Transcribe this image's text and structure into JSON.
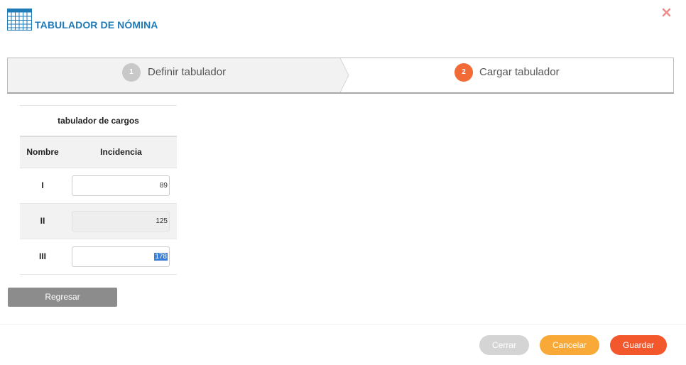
{
  "header": {
    "title": "TABULADOR DE NÓMINA",
    "icon": "grid-table-icon",
    "accent_color": "#1f7ab8",
    "close_icon": "close-x-icon"
  },
  "wizard": {
    "steps": [
      {
        "number": "1",
        "label": "Definir tabulador",
        "state": "completed"
      },
      {
        "number": "2",
        "label": "Cargar tabulador",
        "state": "active"
      }
    ]
  },
  "table": {
    "caption": "tabulador de cargos",
    "headers": {
      "name": "Nombre",
      "incidence": "Incidencia"
    },
    "rows": [
      {
        "name": "I",
        "incidence": "89",
        "editable": true
      },
      {
        "name": "II",
        "incidence": "125",
        "editable": false
      },
      {
        "name": "III",
        "incidence": "178",
        "editable": true,
        "text_selected": true
      }
    ]
  },
  "buttons": {
    "back": "Regresar",
    "close": "Cerrar",
    "cancel": "Cancelar",
    "save": "Guardar"
  },
  "colors": {
    "step_active": "#f26a35",
    "step_done": "#c8c8c8",
    "btn_close": "#d4d4d4",
    "btn_cancel": "#f9a937",
    "btn_save": "#f2582c",
    "btn_back": "#8c8c8c"
  }
}
